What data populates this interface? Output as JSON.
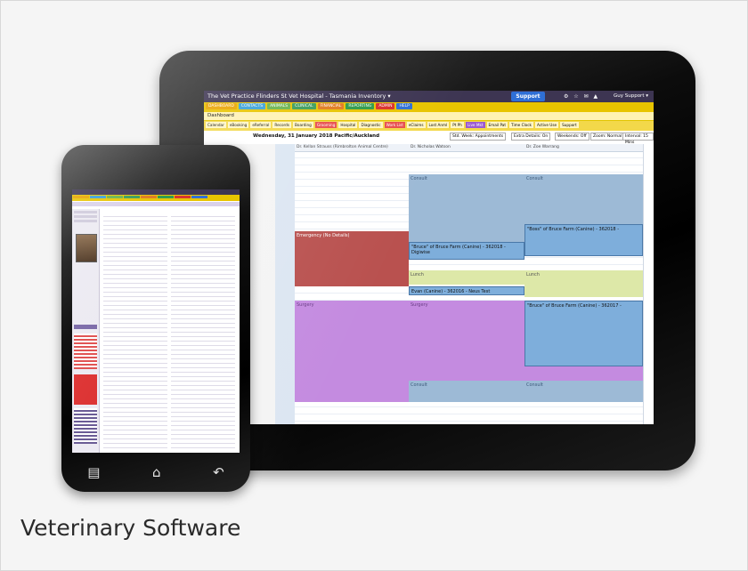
{
  "caption": "Veterinary Software",
  "tablet": {
    "title": "The Vet Practice   Flinders St Vet Hospital - Tasmania Inventory ▾",
    "support_label": "Support",
    "user": "Guy Support ▾",
    "menu": [
      {
        "label": "DASHBOARD",
        "color": "#e8a300"
      },
      {
        "label": "CONTACTS",
        "color": "#39a0d8"
      },
      {
        "label": "ANIMALS",
        "color": "#69b34c"
      },
      {
        "label": "CLINICAL",
        "color": "#3a9b5a"
      },
      {
        "label": "FINANCIAL",
        "color": "#e07a1f"
      },
      {
        "label": "REPORTING",
        "color": "#2e9a4a"
      },
      {
        "label": "ADMIN",
        "color": "#d9302c"
      },
      {
        "label": "HELP",
        "color": "#2f6fd6"
      }
    ],
    "dashboard_label": "Dashboard",
    "tabs": [
      "Calendar",
      "eBooking",
      "eReferral",
      "Records",
      "Boarding",
      "Grooming",
      "Hospital",
      "Diagnostic",
      "Work List",
      "eClaims",
      "Lost Anml",
      "Pt Ph",
      "Live Mkt",
      "Email Pat",
      "Time Clock",
      "Active Use",
      "Support"
    ],
    "date": "Wednesday, 31 January 2018 Pacific/Auckland",
    "controls": [
      "Std. Week: Appointments",
      "Extra Details: On",
      "Weekends: Off",
      "Zoom: Normal",
      "Interval: 15 Mins"
    ],
    "columns": [
      "Dr. Kellan Strauss (Rimbrolton Animal Centre)",
      "Dr. Nicholas Watson",
      "Dr. Zoe Warrang"
    ],
    "blocks": {
      "consult": "Consult",
      "emergency": "Emergency (No Details)",
      "lunch": "Lunch",
      "surgery": "Surgery",
      "appt1": "\"Bruce\" of Bruce Farm (Canine) - 362018 - Digiwise",
      "appt2": "\"Boss\" of Bruce Farm (Canine) - 362018 -",
      "appt3": "Evan (Canine) - 362016 - Neus Test",
      "appt4": "\"Bruce\" of Bruce Farm (Canine) - 362017 -"
    }
  }
}
